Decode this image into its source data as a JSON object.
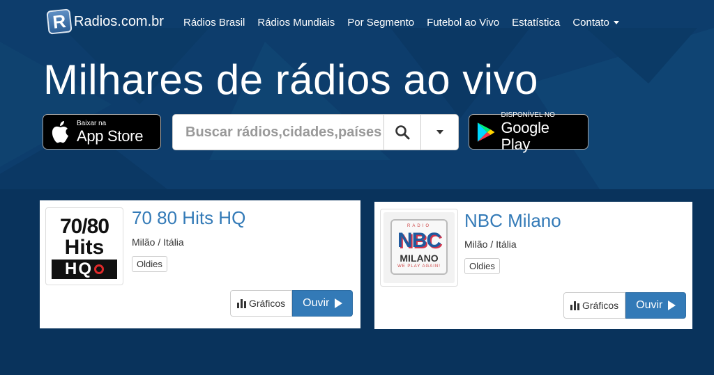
{
  "brand": {
    "logo_letter": "R",
    "name": "Radios.com.br"
  },
  "nav": {
    "items": [
      {
        "label": "Rádios Brasil"
      },
      {
        "label": "Rádios Mundiais"
      },
      {
        "label": "Por Segmento"
      },
      {
        "label": "Futebol ao Vivo"
      },
      {
        "label": "Estatística"
      },
      {
        "label": "Contato"
      }
    ]
  },
  "hero": {
    "headline": "Milhares de rádios ao vivo"
  },
  "appstore": {
    "small": "Baixar na",
    "big": "App Store"
  },
  "googleplay": {
    "small": "DISPONÍVEL NO",
    "big": "Google Play"
  },
  "search": {
    "placeholder": "Buscar rádios,cidades,países",
    "value": ""
  },
  "stations": [
    {
      "title": "70 80 Hits HQ",
      "location": "Milão / Itália",
      "tag": "Oldies",
      "logo_text": [
        "70/80",
        "Hits",
        "HQ"
      ],
      "charts_label": "Gráficos",
      "listen_label": "Ouvir"
    },
    {
      "title": "NBC Milano",
      "location": "Milão / Itália",
      "tag": "Oldies",
      "logo_text": [
        "RADIO",
        "NBC",
        "MILANO",
        "WE PLAY AGAIN!"
      ],
      "charts_label": "Gráficos",
      "listen_label": "Ouvir"
    }
  ],
  "colors": {
    "hero_bg": "#0d3d6c",
    "link": "#337ab7",
    "button": "#337ab7"
  }
}
